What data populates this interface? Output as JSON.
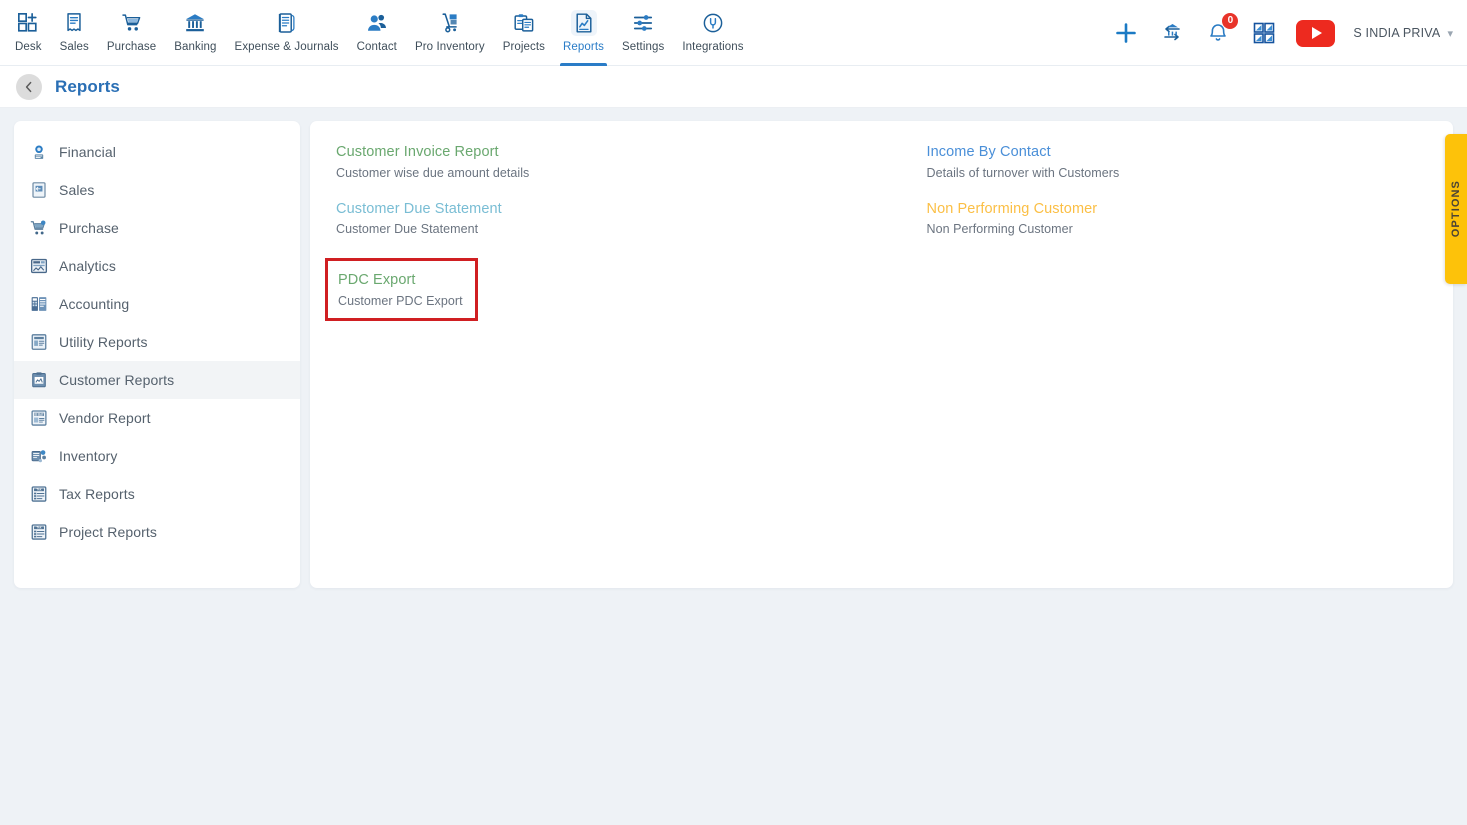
{
  "topnav": {
    "items": [
      {
        "label": "Desk",
        "icon": "dashboard-add-icon",
        "active": false
      },
      {
        "label": "Sales",
        "icon": "receipt-icon",
        "active": false
      },
      {
        "label": "Purchase",
        "icon": "shopping-cart-icon",
        "active": false
      },
      {
        "label": "Banking",
        "icon": "bank-icon",
        "active": false
      },
      {
        "label": "Expense & Journals",
        "icon": "journal-book-icon",
        "active": false
      },
      {
        "label": "Contact",
        "icon": "people-icon",
        "active": false
      },
      {
        "label": "Pro Inventory",
        "icon": "hand-truck-icon",
        "active": false
      },
      {
        "label": "Projects",
        "icon": "clipboard-projects-icon",
        "active": false
      },
      {
        "label": "Reports",
        "icon": "report-chart-icon",
        "active": true
      },
      {
        "label": "Settings",
        "icon": "sliders-icon",
        "active": false
      },
      {
        "label": "Integrations",
        "icon": "plug-icon",
        "active": false
      }
    ],
    "right": {
      "add_icon": "plus-icon",
      "bank_transfer_icon": "bank-transfer-icon",
      "notification_icon": "bell-icon",
      "notification_count": "0",
      "apps_icon": "grid-apps-icon",
      "video_icon": "youtube-play-icon",
      "company_name": "S INDIA PRIVA",
      "chevron_icon": "chevron-down-icon"
    }
  },
  "page_header": {
    "back_icon": "chevron-left-icon",
    "title": "Reports"
  },
  "sidebar": {
    "items": [
      {
        "label": "Financial",
        "icon": "financial-icon",
        "selected": false
      },
      {
        "label": "Sales",
        "icon": "sales-doc-icon",
        "selected": false
      },
      {
        "label": "Purchase",
        "icon": "purchase-cart-icon",
        "selected": false
      },
      {
        "label": "Analytics",
        "icon": "analytics-icon",
        "selected": false
      },
      {
        "label": "Accounting",
        "icon": "accounting-icon",
        "selected": false
      },
      {
        "label": "Utility Reports",
        "icon": "utility-reports-icon",
        "selected": false
      },
      {
        "label": "Customer Reports",
        "icon": "customer-reports-icon",
        "selected": true
      },
      {
        "label": "Vendor Report",
        "icon": "vendor-report-icon",
        "selected": false
      },
      {
        "label": "Inventory",
        "icon": "inventory-icon",
        "selected": false
      },
      {
        "label": "Tax Reports",
        "icon": "tax-reports-icon",
        "selected": false
      },
      {
        "label": "Project Reports",
        "icon": "project-reports-icon",
        "selected": false
      }
    ]
  },
  "main": {
    "left_column": [
      {
        "title": "Customer Invoice Report",
        "description": "Customer wise due amount details",
        "color": "#6aa86f",
        "highlighted": false
      },
      {
        "title": "Customer Due Statement",
        "description": "Customer Due Statement",
        "color": "#79bdd4",
        "highlighted": false
      },
      {
        "title": "PDC Export",
        "description": "Customer PDC Export",
        "color": "#6aa86f",
        "highlighted": true
      }
    ],
    "right_column": [
      {
        "title": "Income By Contact",
        "description": "Details of turnover with Customers",
        "color": "#4a8fd8",
        "highlighted": false
      },
      {
        "title": "Non Performing Customer",
        "description": "Non Performing Customer",
        "color": "#fbbf45",
        "highlighted": false
      }
    ],
    "options_tab_label": "OPTIONS"
  },
  "colors": {
    "accent_blue": "#2a7cc7",
    "highlight_red": "#d01f22",
    "options_yellow": "#fdc20a",
    "page_bg": "#eef2f6"
  }
}
